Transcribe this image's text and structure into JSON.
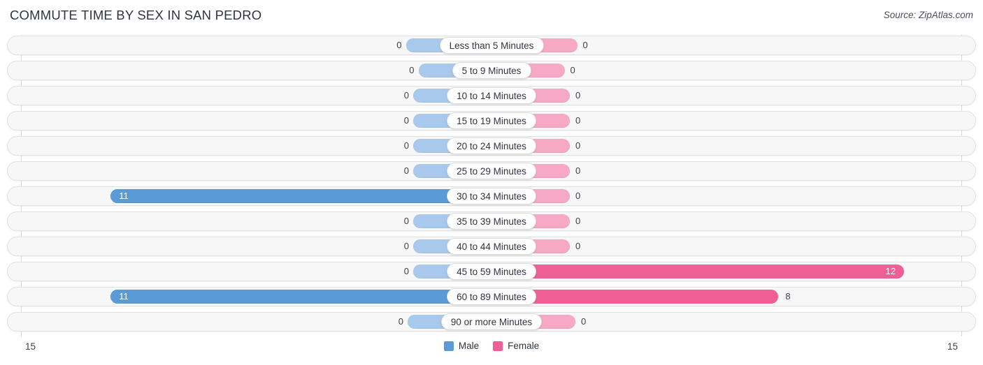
{
  "header": {
    "title": "COMMUTE TIME BY SEX IN SAN PEDRO",
    "source": "Source: ZipAtlas.com"
  },
  "axis": {
    "tick_left": "15",
    "tick_right": "15"
  },
  "legend": {
    "items": [
      {
        "label": "Male",
        "color": "#5b9bd5"
      },
      {
        "label": "Female",
        "color": "#ef5f96"
      }
    ]
  },
  "colors": {
    "male": "#5b9bd5",
    "male_zero": "#a8c9ec",
    "female": "#ef5f96",
    "female_zero": "#f7a8c4",
    "track": "#f7f7f7",
    "track_border": "#e2e2e2"
  },
  "chart_data": {
    "type": "bar",
    "title": "COMMUTE TIME BY SEX IN SAN PEDRO",
    "subtitle": "",
    "orientation": "horizontal-diverging",
    "xlabel": "",
    "ylabel": "",
    "xlim": [
      15,
      15
    ],
    "grid": false,
    "legend_position": "bottom-center",
    "categories": [
      "Less than 5 Minutes",
      "5 to 9 Minutes",
      "10 to 14 Minutes",
      "15 to 19 Minutes",
      "20 to 24 Minutes",
      "25 to 29 Minutes",
      "30 to 34 Minutes",
      "35 to 39 Minutes",
      "40 to 44 Minutes",
      "45 to 59 Minutes",
      "60 to 89 Minutes",
      "90 or more Minutes"
    ],
    "series": [
      {
        "name": "Male",
        "values": [
          0,
          0,
          0,
          0,
          0,
          0,
          11,
          0,
          0,
          0,
          11,
          0
        ]
      },
      {
        "name": "Female",
        "values": [
          0,
          0,
          0,
          0,
          0,
          0,
          0,
          0,
          0,
          12,
          8,
          0
        ]
      }
    ]
  },
  "rows": [
    {
      "label": "Less than 5 Minutes",
      "male": 0,
      "male_text": "0",
      "female": 0,
      "female_text": "0"
    },
    {
      "label": "5 to 9 Minutes",
      "male": 0,
      "male_text": "0",
      "female": 0,
      "female_text": "0"
    },
    {
      "label": "10 to 14 Minutes",
      "male": 0,
      "male_text": "0",
      "female": 0,
      "female_text": "0"
    },
    {
      "label": "15 to 19 Minutes",
      "male": 0,
      "male_text": "0",
      "female": 0,
      "female_text": "0"
    },
    {
      "label": "20 to 24 Minutes",
      "male": 0,
      "male_text": "0",
      "female": 0,
      "female_text": "0"
    },
    {
      "label": "25 to 29 Minutes",
      "male": 0,
      "male_text": "0",
      "female": 0,
      "female_text": "0"
    },
    {
      "label": "30 to 34 Minutes",
      "male": 11,
      "male_text": "11",
      "female": 0,
      "female_text": "0"
    },
    {
      "label": "35 to 39 Minutes",
      "male": 0,
      "male_text": "0",
      "female": 0,
      "female_text": "0"
    },
    {
      "label": "40 to 44 Minutes",
      "male": 0,
      "male_text": "0",
      "female": 0,
      "female_text": "0"
    },
    {
      "label": "45 to 59 Minutes",
      "male": 0,
      "male_text": "0",
      "female": 12,
      "female_text": "12"
    },
    {
      "label": "60 to 89 Minutes",
      "male": 11,
      "male_text": "11",
      "female": 8,
      "female_text": "8"
    },
    {
      "label": "90 or more Minutes",
      "male": 0,
      "male_text": "0",
      "female": 0,
      "female_text": "0"
    }
  ]
}
